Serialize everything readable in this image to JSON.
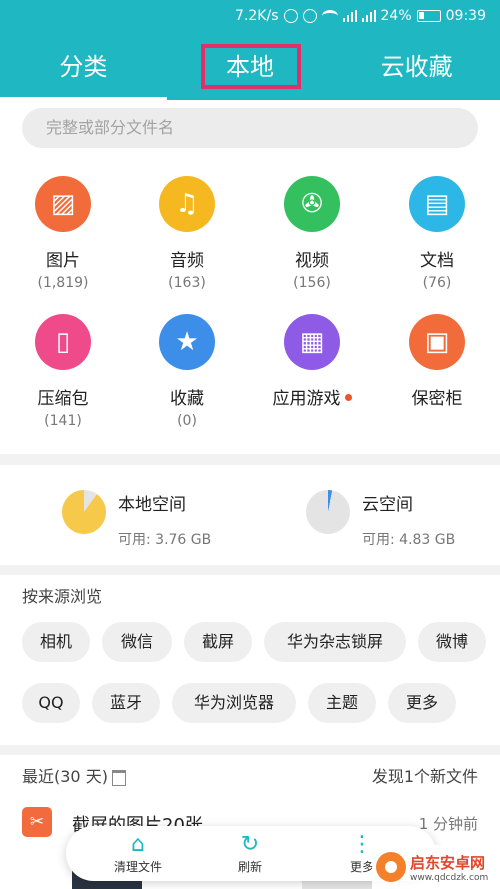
{
  "status_bar": {
    "speed": "7.2K/s",
    "battery": "24%",
    "time": "09:39",
    "net1": "4G",
    "net2": "2G"
  },
  "tabs": [
    {
      "label": "分类"
    },
    {
      "label": "本地"
    },
    {
      "label": "云收藏"
    }
  ],
  "search": {
    "placeholder": "完整或部分文件名"
  },
  "categories": [
    {
      "name": "图片",
      "count": "(1,819)",
      "color": "#f26b3a",
      "icon": "image-icon"
    },
    {
      "name": "音频",
      "count": "(163)",
      "color": "#f6b820",
      "icon": "music-icon"
    },
    {
      "name": "视频",
      "count": "(156)",
      "color": "#34c05f",
      "icon": "film-icon"
    },
    {
      "name": "文档",
      "count": "(76)",
      "color": "#2db7e6",
      "icon": "document-icon"
    },
    {
      "name": "压缩包",
      "count": "(141)",
      "color": "#ef4a8a",
      "icon": "zip-icon"
    },
    {
      "name": "收藏",
      "count": "(0)",
      "color": "#3d8ee8",
      "icon": "star-icon"
    },
    {
      "name": "应用游戏",
      "count": "",
      "color": "#8e5be6",
      "icon": "apps-icon"
    },
    {
      "name": "保密柜",
      "count": "",
      "color": "#f26b3a",
      "icon": "safe-icon"
    }
  ],
  "storage": {
    "local": {
      "title": "本地空间",
      "available": "可用: 3.76 GB",
      "color": "#f6c94a",
      "used_fraction": 0.9
    },
    "cloud": {
      "title": "云空间",
      "available": "可用: 4.83 GB",
      "color": "#3d8ee8",
      "used_fraction": 0.03
    }
  },
  "browse": {
    "title": "按来源浏览",
    "chips": [
      "相机",
      "微信",
      "截屏",
      "华为杂志锁屏",
      "微博",
      "QQ",
      "蓝牙",
      "华为浏览器",
      "主题",
      "更多"
    ]
  },
  "recent": {
    "title": "最近(30 天)",
    "new_files": "发现1个新文件",
    "item_title": "截屏的图片20张",
    "item_time": "1 分钟前"
  },
  "toolbar": {
    "clean": "清理文件",
    "refresh": "刷新",
    "more": "更多"
  },
  "watermark": {
    "cn": "启东安卓网",
    "en": "www.qdcdzk.com"
  }
}
